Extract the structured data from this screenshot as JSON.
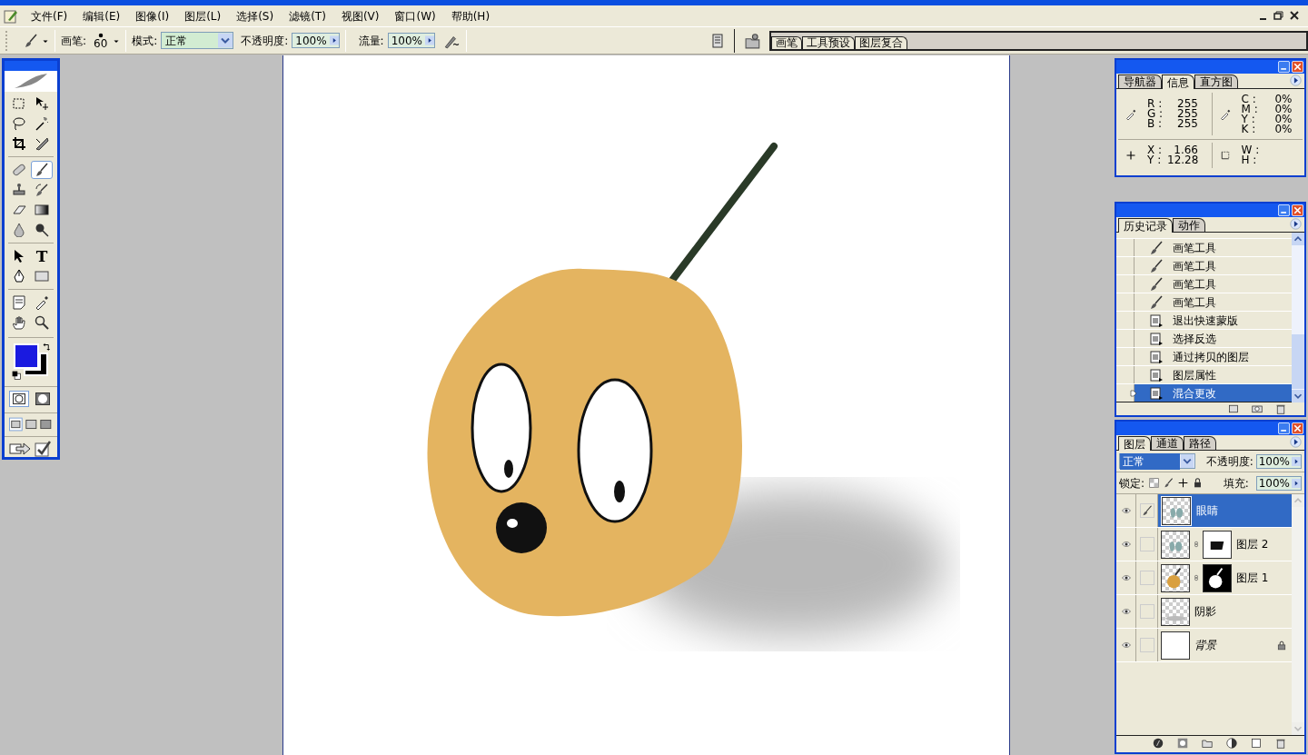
{
  "menu_bar": {
    "items": [
      "文件(F)",
      "编辑(E)",
      "图像(I)",
      "图层(L)",
      "选择(S)",
      "滤镜(T)",
      "视图(V)",
      "窗口(W)",
      "帮助(H)"
    ]
  },
  "options_bar": {
    "brush_label": "画笔:",
    "brush_size": "60",
    "mode_label": "模式:",
    "mode": "正常",
    "opacity_label": "不透明度:",
    "opacity": "100%",
    "flow_label": "流量:",
    "flow": "100%"
  },
  "palette_well": {
    "tabs": [
      "画笔",
      "工具预设",
      "图层复合"
    ]
  },
  "toolbox": {
    "tools": [
      {
        "kind": "marquee",
        "selected": false
      },
      {
        "kind": "move",
        "selected": false
      },
      {
        "kind": "lasso",
        "selected": false
      },
      {
        "kind": "wand",
        "selected": false
      },
      {
        "kind": "crop",
        "selected": false
      },
      {
        "kind": "slice",
        "selected": false
      },
      {
        "kind": "healing",
        "selected": false
      },
      {
        "kind": "brush",
        "selected": true
      },
      {
        "kind": "stamp",
        "selected": false
      },
      {
        "kind": "history",
        "selected": false
      },
      {
        "kind": "eraser",
        "selected": false
      },
      {
        "kind": "gradient",
        "selected": false
      },
      {
        "kind": "blur",
        "selected": false
      },
      {
        "kind": "dodge",
        "selected": false
      },
      {
        "kind": "select",
        "selected": false
      },
      {
        "kind": "type",
        "glyph": "T",
        "selected": false
      },
      {
        "kind": "pen",
        "selected": false
      },
      {
        "kind": "shape",
        "selected": false
      },
      {
        "kind": "notes",
        "selected": false
      },
      {
        "kind": "eyedropper",
        "selected": false
      },
      {
        "kind": "hand",
        "selected": false
      },
      {
        "kind": "zoom",
        "selected": false
      }
    ],
    "swatches": [
      {
        "kind": "foreground",
        "color": "#1a1ae0"
      },
      {
        "kind": "background",
        "color": "#000000"
      }
    ]
  },
  "info_panel": {
    "tabs": [
      {
        "label": "导航器",
        "selected": false
      },
      {
        "label": "信息",
        "selected": true
      },
      {
        "label": "直方图",
        "selected": false
      }
    ],
    "rgb": [
      {
        "label": "R :",
        "value": "255"
      },
      {
        "label": "G :",
        "value": "255"
      },
      {
        "label": "B :",
        "value": "255"
      }
    ],
    "cmyk": [
      {
        "label": "C :",
        "value": "0%"
      },
      {
        "label": "M :",
        "value": "0%"
      },
      {
        "label": "Y :",
        "value": "0%"
      },
      {
        "label": "K :",
        "value": "0%"
      }
    ],
    "position": [
      {
        "label": "X :",
        "value": "1.66"
      },
      {
        "label": "Y :",
        "value": "12.28"
      }
    ],
    "size": [
      {
        "label": "W :"
      },
      {
        "label": "H :"
      }
    ]
  },
  "history_panel": {
    "tabs": [
      {
        "label": "历史记录",
        "selected": true
      },
      {
        "label": "动作",
        "selected": false
      }
    ],
    "items": [
      {
        "label": "画笔工具",
        "kind": "brush",
        "selected": false
      },
      {
        "label": "画笔工具",
        "kind": "brush",
        "selected": false
      },
      {
        "label": "画笔工具",
        "kind": "brush",
        "selected": false
      },
      {
        "label": "画笔工具",
        "kind": "brush",
        "selected": false
      },
      {
        "label": "退出快速蒙版",
        "kind": "command",
        "selected": false
      },
      {
        "label": "选择反选",
        "kind": "command",
        "selected": false
      },
      {
        "label": "通过拷贝的图层",
        "kind": "command",
        "selected": false
      },
      {
        "label": "图层属性",
        "kind": "command",
        "selected": false
      },
      {
        "label": "混合更改",
        "kind": "command",
        "selected": true
      }
    ]
  },
  "layers_panel": {
    "tabs": [
      {
        "label": "图层",
        "selected": true
      },
      {
        "label": "通道",
        "selected": false
      },
      {
        "label": "路径",
        "selected": false
      }
    ],
    "blend_mode": "正常",
    "opacity_label": "不透明度:",
    "opacity": "100%",
    "lock_label": "锁定:",
    "fill_label": "填充:",
    "fill": "100%",
    "layers": [
      {
        "name": "眼睛",
        "kind": "eyes",
        "visible": true,
        "selected": true,
        "locked": false,
        "italic": false
      },
      {
        "name": "图层 2",
        "kind": "eyes-masked",
        "visible": true,
        "selected": false,
        "locked": false,
        "italic": false
      },
      {
        "name": "图层 1",
        "kind": "pear-masked",
        "visible": true,
        "selected": false,
        "locked": false,
        "italic": false
      },
      {
        "name": "阴影",
        "kind": "shadow",
        "visible": true,
        "selected": false,
        "locked": false,
        "italic": false
      },
      {
        "name": "背景",
        "kind": "white",
        "visible": true,
        "selected": false,
        "locked": true,
        "italic": true
      }
    ]
  }
}
